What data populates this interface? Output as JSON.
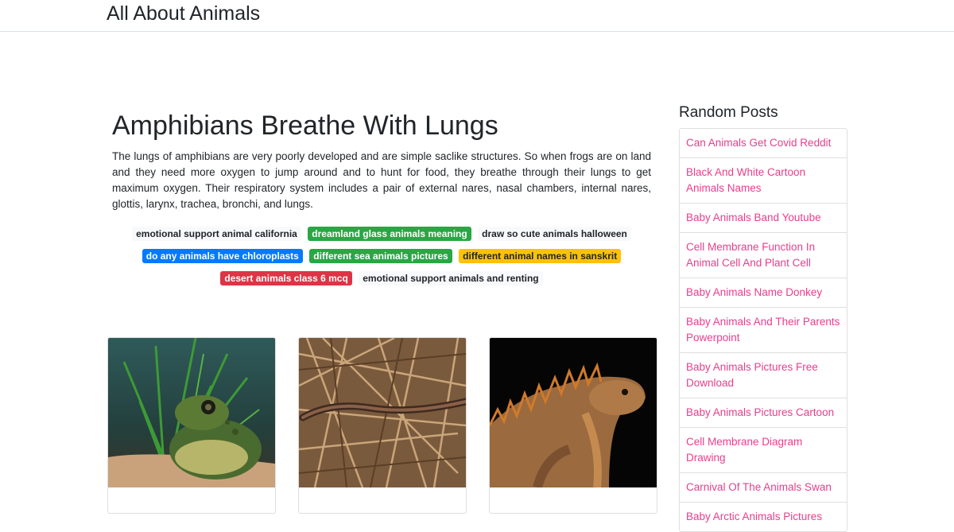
{
  "site": {
    "title": "All About Animals"
  },
  "post": {
    "title": "Amphibians Breathe With Lungs",
    "body": "The lungs of amphibians are very poorly developed and are simple saclike structures. So when frogs are on land and they need more oxygen to jump around and to hunt for food, they breathe through their lungs to get maximum oxygen. Their respiratory system includes a pair of external nares, nasal chambers, internal nares, glottis, larynx, trachea, bronchi, and lungs."
  },
  "tags": [
    {
      "label": "emotional support animal california",
      "color": "#f8f9fa"
    },
    {
      "label": "dreamland glass animals meaning",
      "color": "#28a745"
    },
    {
      "label": "draw so cute animals halloween",
      "color": "#f8f9fa"
    },
    {
      "label": "do any animals have chloroplasts",
      "color": "#007bff"
    },
    {
      "label": "different sea animals pictures",
      "color": "#28a745"
    },
    {
      "label": "different animal names in sanskrit",
      "color": "#ffc107"
    },
    {
      "label": "desert animals class 6 mcq",
      "color": "#dc3545"
    },
    {
      "label": "emotional support animals and renting",
      "color": "#f8f9fa"
    }
  ],
  "cards": [
    {
      "image": "frog-photo"
    },
    {
      "image": "salamander-photo"
    },
    {
      "image": "iguana-photo"
    }
  ],
  "sidebar": {
    "title": "Random Posts",
    "items": [
      "Can Animals Get Covid Reddit",
      "Black And White Cartoon Animals Names",
      "Baby Animals Band Youtube",
      "Cell Membrane Function In Animal Cell And Plant Cell",
      "Baby Animals Name Donkey",
      "Baby Animals And Their Parents Powerpoint",
      "Baby Animals Pictures Free Download",
      "Baby Animals Pictures Cartoon",
      "Cell Membrane Diagram Drawing",
      "Carnival Of The Animals Swan",
      "Baby Arctic Animals Pictures"
    ]
  },
  "colors": {
    "link": "#e83e8c",
    "border": "#dfdfdf",
    "text": "#212529"
  }
}
